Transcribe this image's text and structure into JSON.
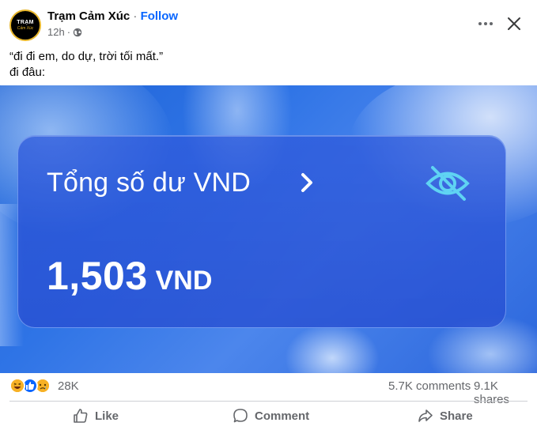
{
  "post": {
    "page_name": "Trạm Cảm Xúc",
    "separator": "·",
    "follow_label": "Follow",
    "time": "12h",
    "audience_icon": "globe-icon",
    "avatar_text_main": "TRẠM",
    "avatar_text_sub": "Cảm Xúc",
    "caption_line1": "“đi đi em, do dự, trời tối mất.”",
    "caption_line2": "đi đâu:"
  },
  "image": {
    "card_title": "Tổng số dư VND",
    "balance_value": "1,503",
    "balance_currency": "VND",
    "chevron_icon": "chevron-right-icon",
    "eye_icon": "eye-hidden-icon",
    "accent_color": "#5fd3f3"
  },
  "stats": {
    "reactions": [
      "haha",
      "like",
      "sad"
    ],
    "reaction_count": "28K",
    "comments": "5.7K comments",
    "shares": "9.1K shares"
  },
  "actions": {
    "like_label": "Like",
    "comment_label": "Comment",
    "share_label": "Share"
  },
  "colors": {
    "follow_blue": "#0866ff",
    "secondary_text": "#65676b"
  }
}
